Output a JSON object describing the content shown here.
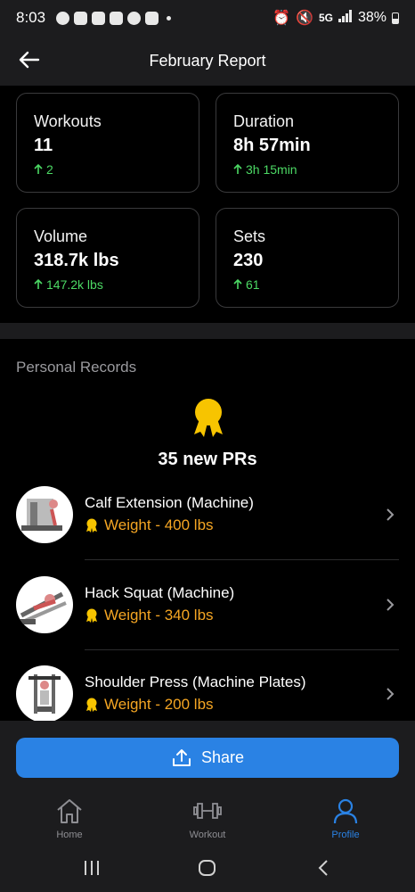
{
  "status_bar": {
    "time": "8:03",
    "network": "5G",
    "battery": "38%"
  },
  "header": {
    "title": "February Report"
  },
  "stats": [
    {
      "label": "Workouts",
      "value": "11",
      "delta": "2"
    },
    {
      "label": "Duration",
      "value": "8h 57min",
      "delta": "3h 15min"
    },
    {
      "label": "Volume",
      "value": "318.7k lbs",
      "delta": "147.2k lbs"
    },
    {
      "label": "Sets",
      "value": "230",
      "delta": "61"
    }
  ],
  "records": {
    "title": "Personal Records",
    "count_label": "35 new PRs",
    "items": [
      {
        "name": "Calf Extension (Machine)",
        "detail": "Weight - 400 lbs"
      },
      {
        "name": "Hack Squat (Machine)",
        "detail": "Weight - 340 lbs"
      },
      {
        "name": "Shoulder Press (Machine Plates)",
        "detail": "Weight - 200 lbs"
      }
    ]
  },
  "share": {
    "label": "Share"
  },
  "tabs": [
    {
      "label": "Home",
      "icon": "home-icon"
    },
    {
      "label": "Workout",
      "icon": "dumbbell-icon"
    },
    {
      "label": "Profile",
      "icon": "profile-icon",
      "active": true
    }
  ],
  "colors": {
    "accent": "#2a82e4",
    "positive": "#4cd964",
    "pr": "#f5a623",
    "medal": "#f7c400"
  }
}
